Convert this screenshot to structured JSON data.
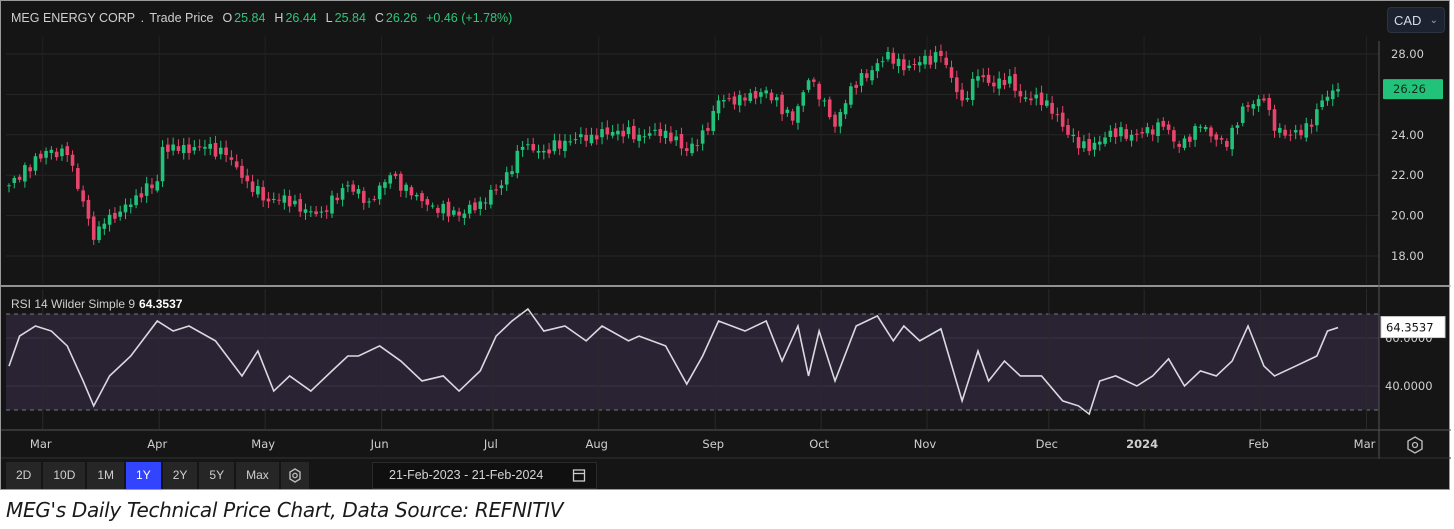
{
  "header": {
    "instrument": "MEG ENERGY CORP",
    "separator": ".",
    "series_label": "Trade Price",
    "open_label": "O",
    "open": "25.84",
    "high_label": "H",
    "high": "26.44",
    "low_label": "L",
    "low": "25.84",
    "close_label": "C",
    "close": "26.26",
    "change": "+0.46 (+1.78%)"
  },
  "currency": {
    "selected": "CAD"
  },
  "rsi": {
    "label": "RSI 14 Wilder Simple 9",
    "value": "64.3537"
  },
  "toolbar": {
    "ranges": [
      "2D",
      "10D",
      "1M",
      "1Y",
      "2Y",
      "5Y",
      "Max"
    ],
    "active_range": "1Y",
    "date_from": "21-Feb-2023",
    "date_sep": "-",
    "date_to": "21-Feb-2024"
  },
  "caption": "MEG's Daily Technical Price Chart, Data Source: REFNITIV",
  "colors": {
    "up": "#22c27a",
    "down": "#e8446c",
    "rsi_line": "#d9d9e0",
    "rsi_band": "#2a2333",
    "active": "#3344ff"
  },
  "chart_data": [
    {
      "type": "candlestick",
      "title": "MEG ENERGY CORP - Trade Price",
      "x_unit": "trading day since 21-Feb-2023",
      "xlim": [
        0,
        251
      ],
      "ylim": [
        17,
        29
      ],
      "yticks": [
        "28.00",
        "26.00",
        "24.00",
        "22.00",
        "20.00",
        "18.00"
      ],
      "ytick_values": [
        28,
        26,
        24,
        22,
        20,
        18
      ],
      "last_price_label": "26.26",
      "xtick_labels": [
        "Mar",
        "Apr",
        "May",
        "Jun",
        "Jul",
        "Aug",
        "Sep",
        "Oct",
        "Nov",
        "Dec",
        "2024",
        "Feb",
        "Mar"
      ],
      "xtick_days": [
        6,
        28,
        48,
        70,
        91,
        111,
        133,
        153,
        173,
        196,
        214,
        236,
        256
      ],
      "close_points": [
        [
          0,
          21.5
        ],
        [
          7,
          23.2
        ],
        [
          11,
          23.0
        ],
        [
          14,
          20.7
        ],
        [
          16,
          18.8
        ],
        [
          18,
          19.6
        ],
        [
          21,
          20.2
        ],
        [
          24,
          21.0
        ],
        [
          28,
          21.7
        ],
        [
          29,
          23.4
        ],
        [
          32,
          23.2
        ],
        [
          37,
          23.4
        ],
        [
          41,
          23.0
        ],
        [
          45,
          21.7
        ],
        [
          49,
          20.7
        ],
        [
          52,
          21.0
        ],
        [
          55,
          20.2
        ],
        [
          59,
          20.2
        ],
        [
          64,
          21.5
        ],
        [
          68,
          20.7
        ],
        [
          72,
          22.0
        ],
        [
          76,
          21.0
        ],
        [
          80,
          20.5
        ],
        [
          85,
          20.0
        ],
        [
          89,
          20.7
        ],
        [
          93,
          21.5
        ],
        [
          97,
          23.4
        ],
        [
          101,
          23.2
        ],
        [
          105,
          23.7
        ],
        [
          110,
          24.0
        ],
        [
          115,
          24.2
        ],
        [
          119,
          24.0
        ],
        [
          124,
          24.2
        ],
        [
          128,
          23.2
        ],
        [
          132,
          24.2
        ],
        [
          134,
          25.7
        ],
        [
          139,
          25.7
        ],
        [
          143,
          26.2
        ],
        [
          148,
          24.7
        ],
        [
          151,
          26.7
        ],
        [
          154,
          25.7
        ],
        [
          156,
          24.4
        ],
        [
          159,
          26.4
        ],
        [
          163,
          27.2
        ],
        [
          166,
          28.1
        ],
        [
          169,
          27.2
        ],
        [
          172,
          27.6
        ],
        [
          176,
          27.9
        ],
        [
          180,
          25.7
        ],
        [
          183,
          26.9
        ],
        [
          186,
          26.4
        ],
        [
          189,
          26.9
        ],
        [
          191,
          25.9
        ],
        [
          196,
          25.7
        ],
        [
          200,
          24.0
        ],
        [
          204,
          23.2
        ],
        [
          208,
          24.2
        ],
        [
          212,
          24.0
        ],
        [
          218,
          24.4
        ],
        [
          221,
          23.4
        ],
        [
          225,
          24.4
        ],
        [
          230,
          23.4
        ],
        [
          233,
          25.4
        ],
        [
          237,
          25.7
        ],
        [
          239,
          24.2
        ],
        [
          242,
          24.0
        ],
        [
          246,
          24.4
        ],
        [
          248,
          25.7
        ],
        [
          251,
          26.26
        ]
      ]
    },
    {
      "type": "line",
      "title": "RSI 14 Wilder Simple 9",
      "ylim": [
        25,
        78
      ],
      "overbought": 70,
      "oversold": 30,
      "yticks": [
        "60.0000",
        "40.0000"
      ],
      "ytick_values": [
        60,
        40
      ],
      "last_value_label": "64.3537",
      "points": [
        [
          0,
          48.3
        ],
        [
          2,
          60.8
        ],
        [
          5,
          65
        ],
        [
          8,
          62.9
        ],
        [
          11,
          56.7
        ],
        [
          14,
          42.1
        ],
        [
          16,
          31.7
        ],
        [
          19,
          44.2
        ],
        [
          23,
          52.5
        ],
        [
          28,
          67.1
        ],
        [
          31,
          62.9
        ],
        [
          34,
          65
        ],
        [
          39,
          58.8
        ],
        [
          44,
          44.2
        ],
        [
          47,
          54.6
        ],
        [
          50,
          37.9
        ],
        [
          53,
          44.2
        ],
        [
          57,
          37.9
        ],
        [
          61,
          46.3
        ],
        [
          64,
          52.5
        ],
        [
          66,
          52.5
        ],
        [
          70,
          56.7
        ],
        [
          74,
          50.4
        ],
        [
          78,
          42.1
        ],
        [
          82,
          44.2
        ],
        [
          85,
          37.9
        ],
        [
          89,
          46.3
        ],
        [
          92,
          60.8
        ],
        [
          95,
          67.1
        ],
        [
          98,
          72.1
        ],
        [
          101,
          62.9
        ],
        [
          105,
          65
        ],
        [
          109,
          58.8
        ],
        [
          112,
          65
        ],
        [
          117,
          58.8
        ],
        [
          119,
          60.8
        ],
        [
          124,
          56.7
        ],
        [
          128,
          40.8
        ],
        [
          131,
          52.5
        ],
        [
          134,
          67.1
        ],
        [
          139,
          62.9
        ],
        [
          143,
          67.1
        ],
        [
          146,
          50.4
        ],
        [
          149,
          65
        ],
        [
          151,
          44.2
        ],
        [
          153,
          62.9
        ],
        [
          156,
          42.1
        ],
        [
          160,
          65
        ],
        [
          164,
          69.2
        ],
        [
          167,
          58.8
        ],
        [
          169,
          65
        ],
        [
          172,
          58.8
        ],
        [
          176,
          63.8
        ],
        [
          180,
          33.8
        ],
        [
          183,
          54.6
        ],
        [
          185,
          42.1
        ],
        [
          188,
          50.4
        ],
        [
          191,
          44.2
        ],
        [
          195,
          44.2
        ],
        [
          199,
          33.8
        ],
        [
          202,
          31.7
        ],
        [
          204,
          28.3
        ],
        [
          206,
          42.1
        ],
        [
          209,
          44.2
        ],
        [
          213,
          40
        ],
        [
          216,
          44.2
        ],
        [
          219,
          51.3
        ],
        [
          222,
          40
        ],
        [
          225,
          46.3
        ],
        [
          228,
          44.2
        ],
        [
          231,
          50.4
        ],
        [
          234,
          65
        ],
        [
          237,
          48.3
        ],
        [
          239,
          44.2
        ],
        [
          243,
          48.3
        ],
        [
          247,
          52.5
        ],
        [
          249,
          62.9
        ],
        [
          251,
          64.35
        ]
      ]
    }
  ]
}
